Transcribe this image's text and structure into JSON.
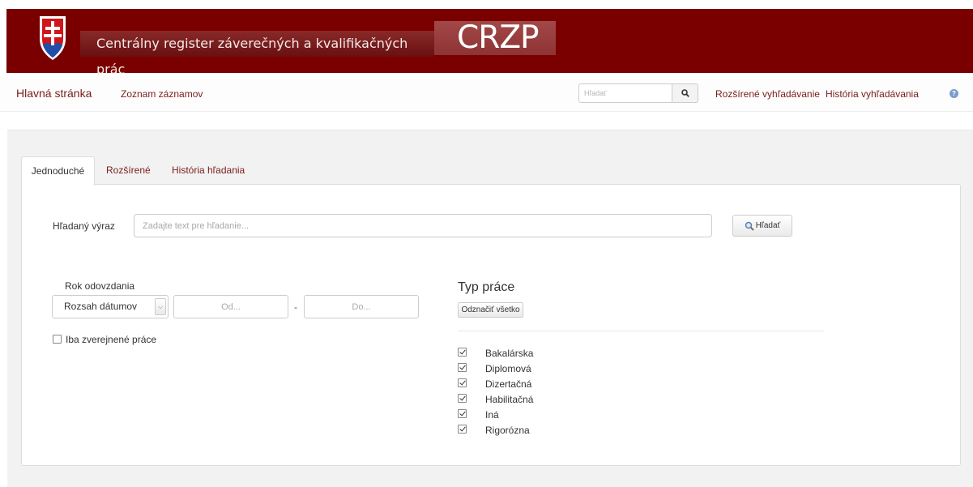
{
  "header": {
    "title": "Centrálny register záverečných a kvalifikačných prác",
    "logo_text": "CRZP"
  },
  "nav": {
    "home": "Hlavná stránka",
    "list": "Zoznam záznamov",
    "search_placeholder": "Hľadať",
    "advanced": "Rozšírené vyhľadávanie",
    "history": "História vyhľadávania"
  },
  "tabs": [
    {
      "label": "Jednoduché",
      "active": true
    },
    {
      "label": "Rozšírené",
      "active": false
    },
    {
      "label": "História hľadania",
      "active": false
    }
  ],
  "form": {
    "query_label": "Hľadaný výraz",
    "query_placeholder": "Zadajte text pre hľadanie...",
    "search_button": "Hľadať",
    "year_label": "Rok odovzdania",
    "range_select": "Rozsah dátumov",
    "from_placeholder": "Od...",
    "to_placeholder": "Do...",
    "separator": "-",
    "published_only": "Iba zverejnené práce",
    "published_checked": false
  },
  "types": {
    "title": "Typ práce",
    "select_all": "Odznačiť všetko",
    "items": [
      {
        "label": "Bakalárska",
        "checked": true
      },
      {
        "label": "Diplomová",
        "checked": true
      },
      {
        "label": "Dizertačná",
        "checked": true
      },
      {
        "label": "Habilitačná",
        "checked": true
      },
      {
        "label": "Iná",
        "checked": true
      },
      {
        "label": "Rigorózna",
        "checked": true
      }
    ]
  },
  "colors": {
    "banner": "#7a0000",
    "link": "#7a1c1c"
  }
}
